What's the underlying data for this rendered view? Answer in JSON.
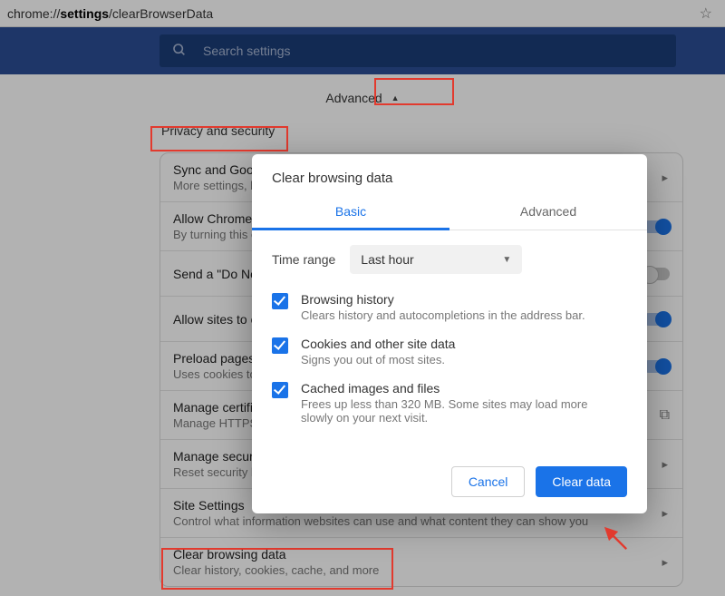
{
  "address": {
    "prefix": "chrome://",
    "bold": "settings",
    "suffix": "/clearBrowserData"
  },
  "search": {
    "placeholder": "Search settings"
  },
  "advanced_label": "Advanced",
  "section_title": "Privacy and security",
  "rows": [
    {
      "title": "Sync and Google services",
      "sub": "More settings, like sync"
    },
    {
      "title": "Allow Chrome sign-in",
      "sub": "By turning this off, you can sign in to Google sites without signing in to Chrome"
    },
    {
      "title": "Send a \"Do Not Track\" request with your browsing traffic",
      "sub": ""
    },
    {
      "title": "Allow sites to check if you have payment methods saved",
      "sub": ""
    },
    {
      "title": "Preload pages for faster browsing and searching",
      "sub": "Uses cookies to remember your preferences, even if you don't visit those pages"
    },
    {
      "title": "Manage certificates",
      "sub": "Manage HTTPS/SSL certificates and settings"
    },
    {
      "title": "Manage security keys",
      "sub": "Reset security keys and create PINs"
    },
    {
      "title": "Site Settings",
      "sub": "Control what information websites can use and what content they can show you"
    },
    {
      "title": "Clear browsing data",
      "sub": "Clear history, cookies, cache, and more"
    }
  ],
  "dialog": {
    "title": "Clear browsing data",
    "tab_basic": "Basic",
    "tab_advanced": "Advanced",
    "time_range_label": "Time range",
    "time_range_value": "Last hour",
    "options": [
      {
        "title": "Browsing history",
        "sub": "Clears history and autocompletions in the address bar."
      },
      {
        "title": "Cookies and other site data",
        "sub": "Signs you out of most sites."
      },
      {
        "title": "Cached images and files",
        "sub": "Frees up less than 320 MB. Some sites may load more slowly on your next visit."
      }
    ],
    "cancel": "Cancel",
    "clear": "Clear data"
  }
}
